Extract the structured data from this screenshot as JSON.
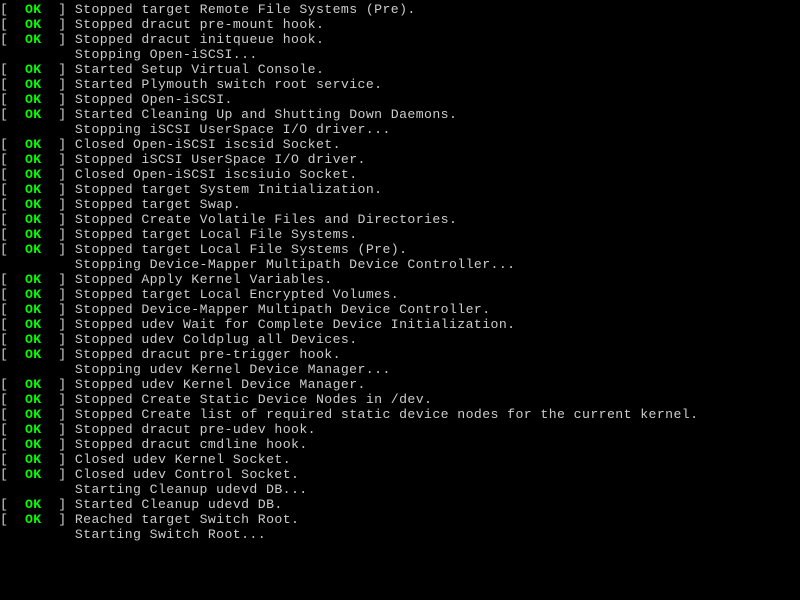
{
  "status_ok": "OK",
  "lbracket": "[  ",
  "rbracket": "  ] ",
  "indent": "         ",
  "lines": [
    {
      "type": "ok",
      "msg": "Stopped target Remote File Systems (Pre)."
    },
    {
      "type": "ok",
      "msg": "Stopped dracut pre-mount hook."
    },
    {
      "type": "ok",
      "msg": "Stopped dracut initqueue hook."
    },
    {
      "type": "plain",
      "msg": "Stopping Open-iSCSI..."
    },
    {
      "type": "ok",
      "msg": "Started Setup Virtual Console."
    },
    {
      "type": "ok",
      "msg": "Started Plymouth switch root service."
    },
    {
      "type": "ok",
      "msg": "Stopped Open-iSCSI."
    },
    {
      "type": "ok",
      "msg": "Started Cleaning Up and Shutting Down Daemons."
    },
    {
      "type": "plain",
      "msg": "Stopping iSCSI UserSpace I/O driver..."
    },
    {
      "type": "ok",
      "msg": "Closed Open-iSCSI iscsid Socket."
    },
    {
      "type": "ok",
      "msg": "Stopped iSCSI UserSpace I/O driver."
    },
    {
      "type": "ok",
      "msg": "Closed Open-iSCSI iscsiuio Socket."
    },
    {
      "type": "ok",
      "msg": "Stopped target System Initialization."
    },
    {
      "type": "ok",
      "msg": "Stopped target Swap."
    },
    {
      "type": "ok",
      "msg": "Stopped Create Volatile Files and Directories."
    },
    {
      "type": "ok",
      "msg": "Stopped target Local File Systems."
    },
    {
      "type": "ok",
      "msg": "Stopped target Local File Systems (Pre)."
    },
    {
      "type": "plain",
      "msg": "Stopping Device-Mapper Multipath Device Controller..."
    },
    {
      "type": "ok",
      "msg": "Stopped Apply Kernel Variables."
    },
    {
      "type": "ok",
      "msg": "Stopped target Local Encrypted Volumes."
    },
    {
      "type": "ok",
      "msg": "Stopped Device-Mapper Multipath Device Controller."
    },
    {
      "type": "ok",
      "msg": "Stopped udev Wait for Complete Device Initialization."
    },
    {
      "type": "ok",
      "msg": "Stopped udev Coldplug all Devices."
    },
    {
      "type": "ok",
      "msg": "Stopped dracut pre-trigger hook."
    },
    {
      "type": "plain",
      "msg": "Stopping udev Kernel Device Manager..."
    },
    {
      "type": "ok",
      "msg": "Stopped udev Kernel Device Manager."
    },
    {
      "type": "ok",
      "msg": "Stopped Create Static Device Nodes in /dev."
    },
    {
      "type": "ok",
      "msg": "Stopped Create list of required static device nodes for the current kernel."
    },
    {
      "type": "ok",
      "msg": "Stopped dracut pre-udev hook."
    },
    {
      "type": "ok",
      "msg": "Stopped dracut cmdline hook."
    },
    {
      "type": "ok",
      "msg": "Closed udev Kernel Socket."
    },
    {
      "type": "ok",
      "msg": "Closed udev Control Socket."
    },
    {
      "type": "plain",
      "msg": "Starting Cleanup udevd DB..."
    },
    {
      "type": "ok",
      "msg": "Started Cleanup udevd DB."
    },
    {
      "type": "ok",
      "msg": "Reached target Switch Root."
    },
    {
      "type": "plain",
      "msg": "Starting Switch Root..."
    }
  ]
}
